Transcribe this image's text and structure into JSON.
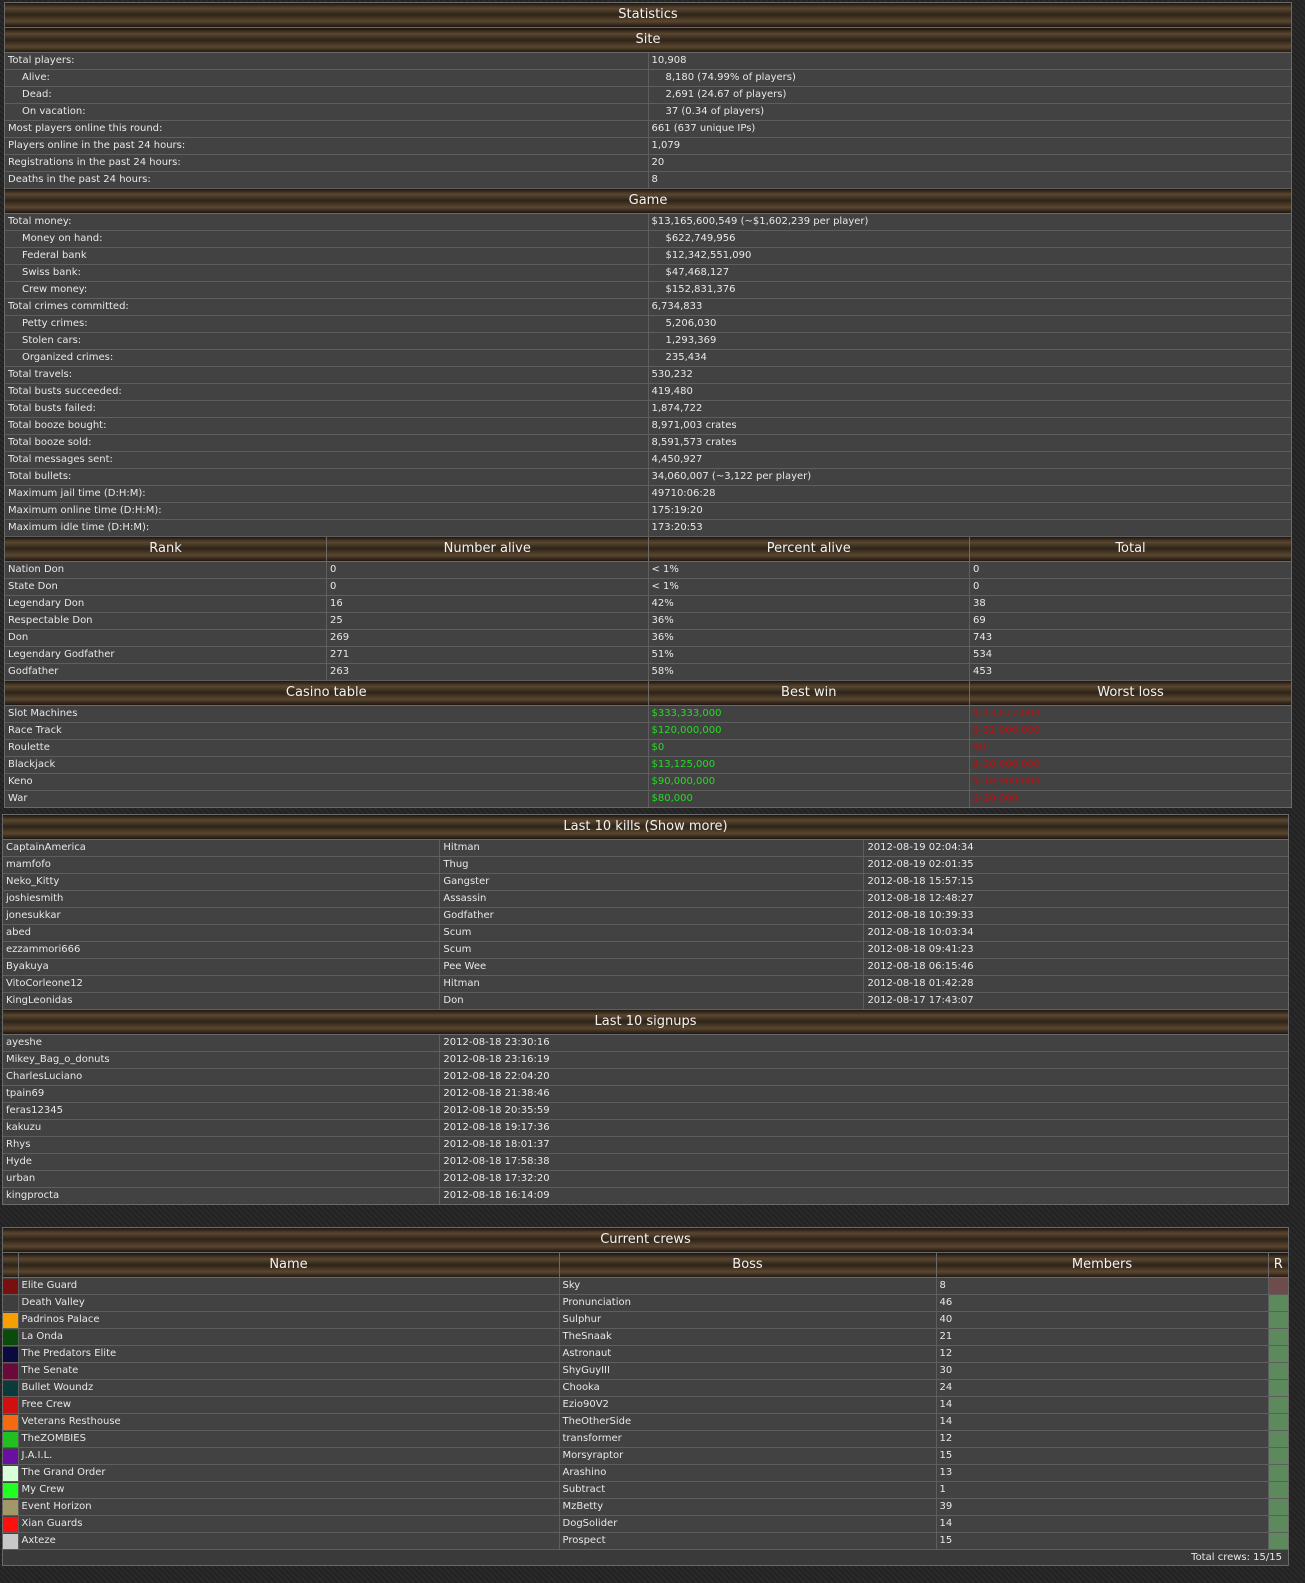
{
  "statistics": {
    "title": "Statistics",
    "site_header": "Site",
    "site_rows": [
      {
        "label": "Total players:",
        "value": "10,908",
        "sub": false
      },
      {
        "label": "Alive:",
        "value": "8,180 (74.99% of players)",
        "sub": true
      },
      {
        "label": "Dead:",
        "value": "2,691 (24.67 of players)",
        "sub": true
      },
      {
        "label": "On vacation:",
        "value": "37 (0.34 of players)",
        "sub": true
      },
      {
        "label": "Most players online this round:",
        "value": "661 (637 unique IPs)",
        "sub": false
      },
      {
        "label": "Players online in the past 24 hours:",
        "value": "1,079",
        "sub": false
      },
      {
        "label": "Registrations in the past 24 hours:",
        "value": "20",
        "sub": false
      },
      {
        "label": "Deaths in the past 24 hours:",
        "value": "8",
        "sub": false
      }
    ],
    "game_header": "Game",
    "game_rows": [
      {
        "label": "Total money:",
        "value": "$13,165,600,549 (~$1,602,239 per player)",
        "sub": false
      },
      {
        "label": "Money on hand:",
        "value": "$622,749,956",
        "sub": true
      },
      {
        "label": "Federal bank",
        "value": "$12,342,551,090",
        "sub": true
      },
      {
        "label": "Swiss bank:",
        "value": "$47,468,127",
        "sub": true
      },
      {
        "label": "Crew money:",
        "value": "$152,831,376",
        "sub": true
      },
      {
        "label": "Total crimes committed:",
        "value": "6,734,833",
        "sub": false
      },
      {
        "label": "Petty crimes:",
        "value": "5,206,030",
        "sub": true
      },
      {
        "label": "Stolen cars:",
        "value": "1,293,369",
        "sub": true
      },
      {
        "label": "Organized crimes:",
        "value": "235,434",
        "sub": true
      },
      {
        "label": "Total travels:",
        "value": "530,232",
        "sub": false
      },
      {
        "label": "Total busts succeeded:",
        "value": "419,480",
        "sub": false
      },
      {
        "label": "Total busts failed:",
        "value": "1,874,722",
        "sub": false
      },
      {
        "label": "Total booze bought:",
        "value": "8,971,003 crates",
        "sub": false
      },
      {
        "label": "Total booze sold:",
        "value": "8,591,573 crates",
        "sub": false
      },
      {
        "label": "Total messages sent:",
        "value": "4,450,927",
        "sub": false
      },
      {
        "label": "Total bullets:",
        "value": "34,060,007 (~3,122 per player)",
        "sub": false
      },
      {
        "label": "Maximum jail time (D:H:M):",
        "value": "49710:06:28",
        "sub": false
      },
      {
        "label": "Maximum online time (D:H:M):",
        "value": "175:19:20",
        "sub": false
      },
      {
        "label": "Maximum idle time (D:H:M):",
        "value": "173:20:53",
        "sub": false
      }
    ],
    "rank_headers": [
      "Rank",
      "Number alive",
      "Percent alive",
      "Total"
    ],
    "rank_rows": [
      [
        "Nation Don",
        "0",
        "< 1%",
        "0"
      ],
      [
        "State Don",
        "0",
        "< 1%",
        "0"
      ],
      [
        "Legendary Don",
        "16",
        "42%",
        "38"
      ],
      [
        "Respectable Don",
        "25",
        "36%",
        "69"
      ],
      [
        "Don",
        "269",
        "36%",
        "743"
      ],
      [
        "Legendary Godfather",
        "271",
        "51%",
        "534"
      ],
      [
        "Godfather",
        "263",
        "58%",
        "453"
      ]
    ],
    "casino_headers": [
      "Casino table",
      "Best win",
      "Worst loss"
    ],
    "casino_rows": [
      [
        "Slot Machines",
        "$333,333,000",
        "$-13,877,000"
      ],
      [
        "Race Track",
        "$120,000,000",
        "$-32,000,000"
      ],
      [
        "Roulette",
        "$0",
        "$0"
      ],
      [
        "Blackjack",
        "$13,125,000",
        "$-20,000,000"
      ],
      [
        "Keno",
        "$90,000,000",
        "$-18,900,000"
      ],
      [
        "War",
        "$80,000",
        "$-20,000"
      ]
    ]
  },
  "kills": {
    "header": "Last 10 kills (Show more)",
    "rows": [
      [
        "CaptainAmerica",
        "Hitman",
        "2012-08-19 02:04:34"
      ],
      [
        "mamfofo",
        "Thug",
        "2012-08-19 02:01:35"
      ],
      [
        "Neko_Kitty",
        "Gangster",
        "2012-08-18 15:57:15"
      ],
      [
        "joshiesmith",
        "Assassin",
        "2012-08-18 12:48:27"
      ],
      [
        "jonesukkar",
        "Godfather",
        "2012-08-18 10:39:33"
      ],
      [
        "abed",
        "Scum",
        "2012-08-18 10:03:34"
      ],
      [
        "ezzammori666",
        "Scum",
        "2012-08-18 09:41:23"
      ],
      [
        "Byakuya",
        "Pee Wee",
        "2012-08-18 06:15:46"
      ],
      [
        "VitoCorleone12",
        "Hitman",
        "2012-08-18 01:42:28"
      ],
      [
        "KingLeonidas",
        "Don",
        "2012-08-17 17:43:07"
      ]
    ]
  },
  "signups": {
    "header": "Last 10 signups",
    "rows": [
      [
        "ayeshe",
        "2012-08-18 23:30:16"
      ],
      [
        "Mikey_Bag_o_donuts",
        "2012-08-18 23:16:19"
      ],
      [
        "CharlesLuciano",
        "2012-08-18 22:04:20"
      ],
      [
        "tpain69",
        "2012-08-18 21:38:46"
      ],
      [
        "feras12345",
        "2012-08-18 20:35:59"
      ],
      [
        "kakuzu",
        "2012-08-18 19:17:36"
      ],
      [
        "Rhys",
        "2012-08-18 18:01:37"
      ],
      [
        "Hyde",
        "2012-08-18 17:58:38"
      ],
      [
        "urban",
        "2012-08-18 17:32:20"
      ],
      [
        "kingprocta",
        "2012-08-18 16:14:09"
      ]
    ]
  },
  "crews": {
    "header": "Current crews",
    "columns": [
      "Name",
      "Boss",
      "Members",
      "R"
    ],
    "rows": [
      {
        "color": "#7a0f0f",
        "name": "Elite Guard",
        "boss": "Sky",
        "members": "8",
        "r_color": "#6e4c4c"
      },
      {
        "color": "#3e3e3e",
        "name": "Death Valley",
        "boss": "Pronunciation",
        "members": "46",
        "r_color": "#5c8a5c"
      },
      {
        "color": "#f5a000",
        "name": "Padrinos Palace",
        "boss": "Sulphur",
        "members": "40",
        "r_color": "#5c8a5c"
      },
      {
        "color": "#0a4a0a",
        "name": "La Onda",
        "boss": "TheSnaak",
        "members": "21",
        "r_color": "#5c8a5c"
      },
      {
        "color": "#0a0a40",
        "name": "The Predators Elite",
        "boss": "Astronaut",
        "members": "12",
        "r_color": "#5c8a5c"
      },
      {
        "color": "#6a0a3a",
        "name": "The Senate",
        "boss": "ShyGuyIII",
        "members": "30",
        "r_color": "#5c8a5c"
      },
      {
        "color": "#0a3a3a",
        "name": "Bullet Woundz",
        "boss": "Chooka",
        "members": "24",
        "r_color": "#5c8a5c"
      },
      {
        "color": "#d01010",
        "name": "Free Crew",
        "boss": "Ezio90V2",
        "members": "14",
        "r_color": "#5c8a5c"
      },
      {
        "color": "#f56a10",
        "name": "Veterans Resthouse",
        "boss": "TheOtherSide",
        "members": "14",
        "r_color": "#5c8a5c"
      },
      {
        "color": "#20c020",
        "name": "TheZOMBIES",
        "boss": "transformer",
        "members": "12",
        "r_color": "#5c8a5c"
      },
      {
        "color": "#6a10a0",
        "name": "J.A.I.L.",
        "boss": "Morsyraptor",
        "members": "15",
        "r_color": "#5c8a5c"
      },
      {
        "color": "#d8ffd8",
        "name": "The Grand Order",
        "boss": "Arashino",
        "members": "13",
        "r_color": "#5c8a5c"
      },
      {
        "color": "#20ff20",
        "name": "My Crew",
        "boss": "Subtract",
        "members": "1",
        "r_color": "#5c8a5c"
      },
      {
        "color": "#a09868",
        "name": "Event Horizon",
        "boss": "MzBetty",
        "members": "39",
        "r_color": "#5c8a5c"
      },
      {
        "color": "#ff1010",
        "name": "Xian Guards",
        "boss": "DogSolider",
        "members": "14",
        "r_color": "#5c8a5c"
      },
      {
        "color": "#c8c8c8",
        "name": "Axteze",
        "boss": "Prospect",
        "members": "15",
        "r_color": "#5c8a5c"
      }
    ],
    "total": "Total crews: 15/15"
  },
  "colors": {
    "win": "#22dd22",
    "loss": "#b01515",
    "row_bg": "#424242",
    "border": "#5e5e5e"
  }
}
